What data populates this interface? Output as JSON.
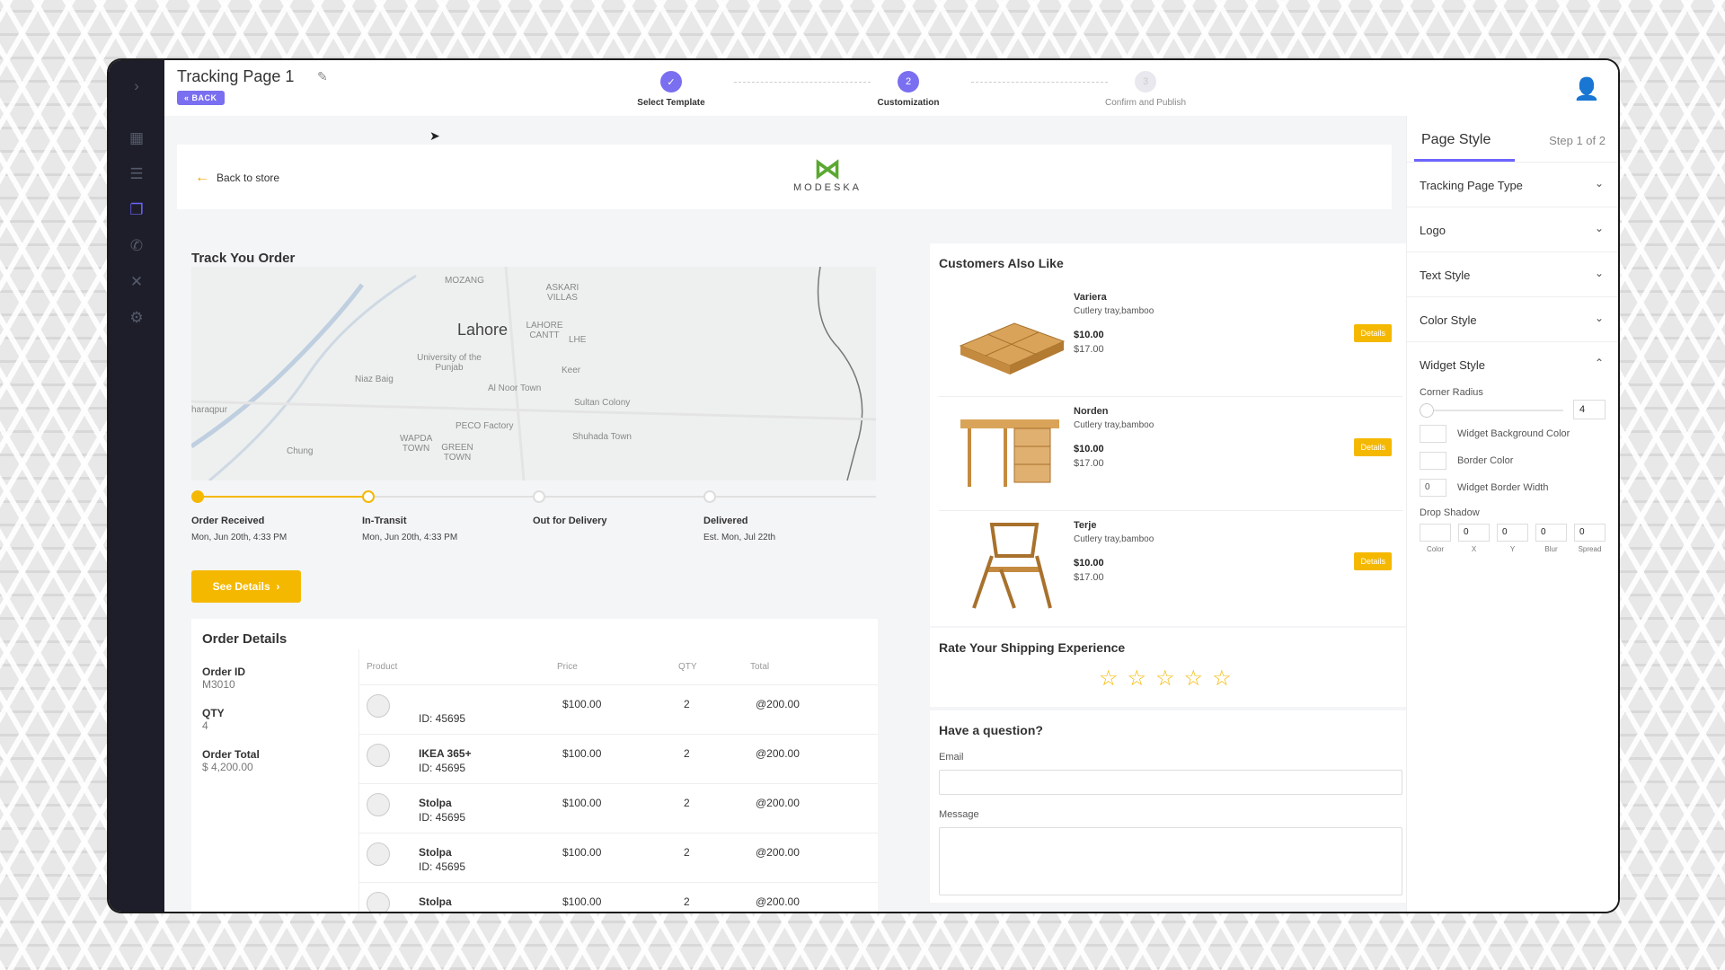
{
  "header": {
    "title": "Tracking Page 1",
    "back_label": "« BACK",
    "steps": [
      {
        "label": "Select Template",
        "state": "done"
      },
      {
        "label": "Customization",
        "state": "current",
        "num": "2"
      },
      {
        "label": "Confirm and Publish",
        "state": "pending",
        "num": "3"
      }
    ]
  },
  "store": {
    "back_label": "Back to store",
    "brand": "MODESKA"
  },
  "tracking": {
    "heading": "Track You Order",
    "map_labels": {
      "city": "Lahore",
      "l1": "MOZANG",
      "l2": "LAHORE CANTT",
      "l3": "ASKARI VILLAS",
      "l4": "LHE",
      "l5": "University of the Punjab",
      "l6": "Niaz Baig",
      "l7": "Al Noor Town",
      "l8": "Keer",
      "l9": "Sultan Colony",
      "l10": "PECO Factory",
      "l11": "Shuhada Town",
      "l12": "WAPDA TOWN",
      "l13": "GREEN TOWN",
      "l14": "Chung",
      "l15": "haraqpur"
    },
    "statuses": [
      {
        "label": "Order Received",
        "date": "Mon, Jun 20th, 4:33 PM"
      },
      {
        "label": "In-Transit",
        "date": "Mon, Jun 20th, 4:33 PM"
      },
      {
        "label": "Out for Delivery",
        "date": ""
      },
      {
        "label": "Delivered",
        "date": "Est. Mon, Jul 22th"
      }
    ],
    "progress": 0.25,
    "see_details": "See Details"
  },
  "order": {
    "heading": "Order Details",
    "id_label": "Order ID",
    "id": "M3010",
    "qty_label": "QTY",
    "qty": "4",
    "total_label": "Order Total",
    "total": "$ 4,200.00",
    "columns": [
      "Product",
      "Price",
      "QTY",
      "Total"
    ],
    "rows": [
      {
        "name": "",
        "pid": "ID: 45695",
        "price": "$100.00",
        "qty": "2",
        "total": "@200.00"
      },
      {
        "name": "IKEA 365+",
        "pid": "ID: 45695",
        "price": "$100.00",
        "qty": "2",
        "total": "@200.00"
      },
      {
        "name": "Stolpa",
        "pid": "ID: 45695",
        "price": "$100.00",
        "qty": "2",
        "total": "@200.00"
      },
      {
        "name": "Stolpa",
        "pid": "ID: 45695",
        "price": "$100.00",
        "qty": "2",
        "total": "@200.00"
      },
      {
        "name": "Stolpa",
        "pid": "",
        "price": "$100.00",
        "qty": "2",
        "total": "@200.00"
      }
    ]
  },
  "also_like": {
    "heading": "Customers Also Like",
    "products": [
      {
        "name": "Variera",
        "desc": "Cutlery tray,bamboo",
        "price": "$10.00",
        "old": "$17.00",
        "btn": "Details"
      },
      {
        "name": "Norden",
        "desc": "Cutlery tray,bamboo",
        "price": "$10.00",
        "old": "$17.00",
        "btn": "Details"
      },
      {
        "name": "Terje",
        "desc": "Cutlery tray,bamboo",
        "price": "$10.00",
        "old": "$17.00",
        "btn": "Details"
      }
    ]
  },
  "rating": {
    "heading": "Rate Your Shipping Experience",
    "stars": 5
  },
  "question": {
    "heading": "Have a question?",
    "email_label": "Email",
    "message_label": "Message"
  },
  "panel": {
    "tab": "Page Style",
    "step": "Step 1 of 2",
    "sections": [
      "Tracking Page Type",
      "Logo",
      "Text Style",
      "Color Style"
    ],
    "widget": {
      "title": "Widget Style",
      "corner_label": "Corner Radius",
      "corner_value": "4",
      "bg_label": "Widget Background Color",
      "border_label": "Border Color",
      "bw_label": "Widget Border Width",
      "bw_value": "0",
      "shadow_label": "Drop Shadow",
      "shadow_caps": [
        "Color",
        "X",
        "Y",
        "Blur",
        "Spread"
      ],
      "shadow_values": [
        "",
        "0",
        "0",
        "0",
        "0"
      ]
    }
  },
  "colors": {
    "accent": "#6c63ff",
    "yellow": "#f5b800",
    "sidebar": "#1e1e2a",
    "brand_green": "#5aa832"
  }
}
